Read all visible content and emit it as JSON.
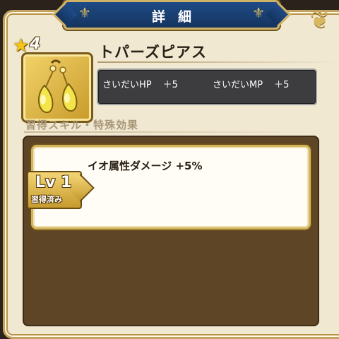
{
  "header": {
    "title": "詳細"
  },
  "item": {
    "rarity": "4",
    "name": "トパーズピアス",
    "icon": "topaz-earring-icon"
  },
  "stats": [
    {
      "label": "さいだいHP",
      "value": "＋5"
    },
    {
      "label": "さいだいMP",
      "value": "＋5"
    }
  ],
  "skills_section": {
    "heading": "習得スキル・特殊効果",
    "skills": [
      {
        "level": "Lv 1",
        "status": "習得済み",
        "effect": "イオ属性ダメージ +5%"
      }
    ]
  },
  "colors": {
    "title_bar": "#1f4b86",
    "gold_trim": "#d0b264",
    "panel_bg": "#f1e8d2",
    "stat_box": "#3d3d3f",
    "skills_bg": "#5d4526"
  }
}
